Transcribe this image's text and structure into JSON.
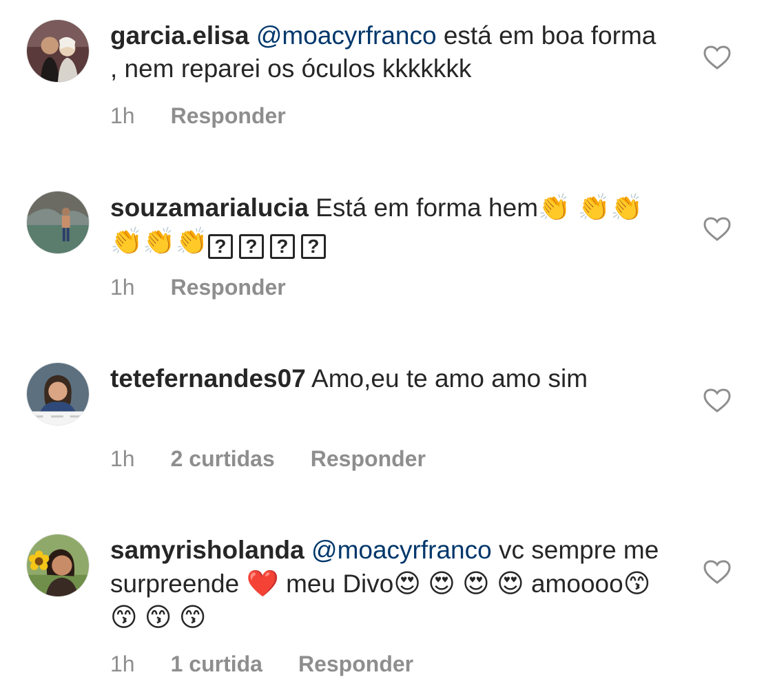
{
  "colors": {
    "text": "#262626",
    "mention": "#00376b",
    "meta": "#8e8e8e",
    "heart_outline": "#8e8e8e"
  },
  "comments": [
    {
      "username": "garcia.elisa",
      "mention": "@moacyrfranco",
      "text_after_mention": " está em boa forma , nem reparei os óculos kkkkkkk",
      "time": "1h",
      "likes": "",
      "reply": "Responder",
      "avatar_icon": "avatar-photo"
    },
    {
      "username": "souzamarialucia",
      "text": " Está  em forma hem",
      "emoji_clap": "👏",
      "unknown_glyph": "?",
      "time": "1h",
      "likes": "",
      "reply": "Responder",
      "avatar_icon": "avatar-photo"
    },
    {
      "username": "tetefernandes07",
      "text": " Amo,eu te amo amo sim",
      "time": "1h",
      "likes": "2 curtidas",
      "reply": "Responder",
      "avatar_icon": "avatar-photo"
    },
    {
      "username": "samyrisholanda",
      "mention": "@moacyrfranco",
      "text_after_mention": " vc sempre me surpreende ",
      "emoji_heart": "❤️",
      "text_middle": " meu Divo",
      "emoji_heart_eyes": "😍",
      "text_amoooo": " amoooo",
      "emoji_kiss": "😙",
      "time": "1h",
      "likes": "1 curtida",
      "reply": "Responder",
      "avatar_icon": "avatar-photo"
    }
  ],
  "icons": {
    "like": "heart-outline-icon"
  }
}
